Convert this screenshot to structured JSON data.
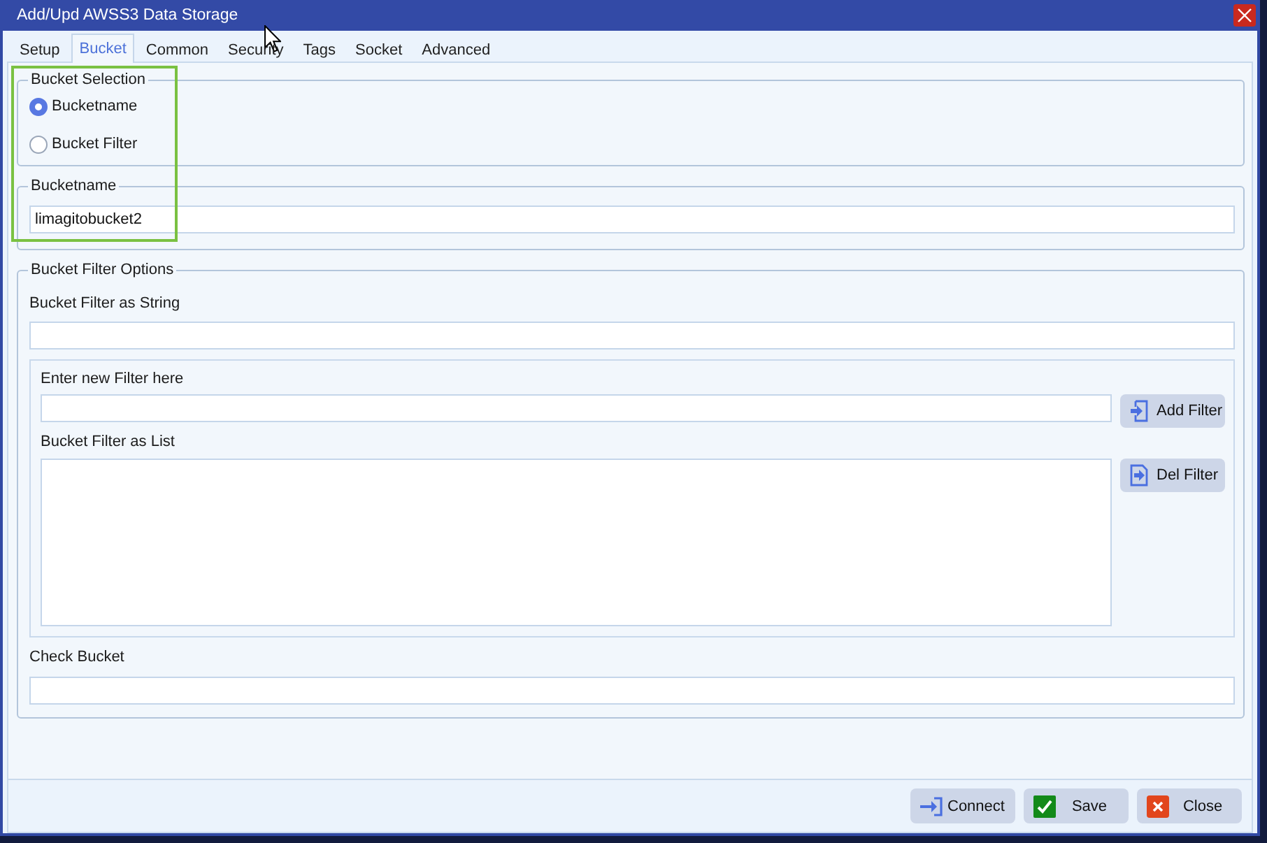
{
  "window": {
    "title": "Add/Upd AWSS3 Data Storage"
  },
  "tabs": [
    {
      "label": "Setup",
      "selected": false
    },
    {
      "label": "Bucket",
      "selected": true
    },
    {
      "label": "Common",
      "selected": false
    },
    {
      "label": "Security",
      "selected": false
    },
    {
      "label": "Tags",
      "selected": false
    },
    {
      "label": "Socket",
      "selected": false
    },
    {
      "label": "Advanced",
      "selected": false
    }
  ],
  "bucket_selection": {
    "legend": "Bucket Selection",
    "options": [
      {
        "label": "Bucketname",
        "selected": true
      },
      {
        "label": "Bucket Filter",
        "selected": false
      }
    ]
  },
  "bucketname": {
    "legend": "Bucketname",
    "value": "limagitobucket2"
  },
  "bucket_filter_options": {
    "legend": "Bucket Filter Options",
    "string_field": {
      "label": "Bucket Filter as String"
    },
    "new_filter": {
      "label": "Enter new Filter here",
      "button": "Add Filter"
    },
    "filter_list": {
      "label": "Bucket Filter as List",
      "button": "Del Filter"
    },
    "check_bucket": {
      "label": "Check Bucket"
    }
  },
  "buttons": [
    {
      "kind": "connect",
      "label": "Connect"
    },
    {
      "kind": "save",
      "label": "Save"
    },
    {
      "kind": "close",
      "label": "Close"
    }
  ]
}
